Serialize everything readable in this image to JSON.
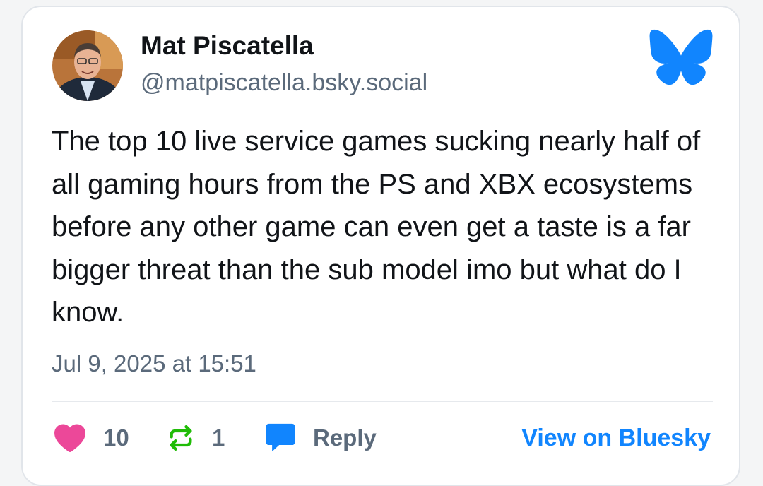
{
  "post": {
    "author_name": "Mat Piscatella",
    "author_handle": "@matpiscatella.bsky.social",
    "text": "The top 10 live service games sucking nearly half of all gaming hours from the PS and XBX ecosystems before any other game can even get a taste is a far bigger threat than the sub model imo but what do I know.",
    "timestamp": "Jul 9, 2025 at 15:51"
  },
  "actions": {
    "like_count": "10",
    "repost_count": "1",
    "reply_label": "Reply",
    "view_label": "View on Bluesky"
  },
  "icons": {
    "logo": "bluesky-butterfly-icon",
    "like": "heart-icon",
    "repost": "repost-icon",
    "reply": "speech-bubble-icon"
  },
  "colors": {
    "brand_blue": "#1185fe",
    "like_pink": "#ec4899",
    "repost_green": "#20bc07",
    "muted_text": "#5b6a7b"
  }
}
